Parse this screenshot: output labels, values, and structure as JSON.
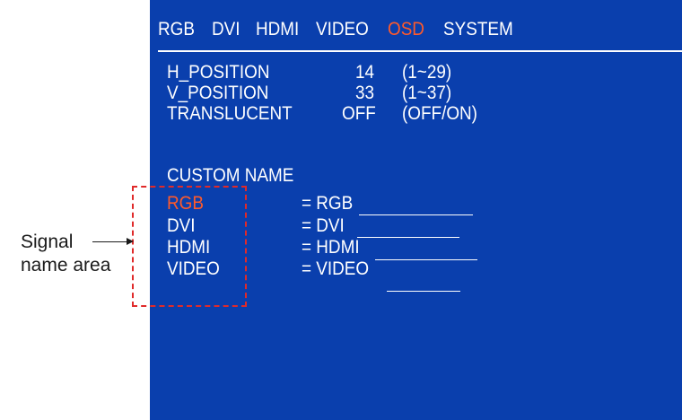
{
  "tabs": [
    {
      "label": "RGB",
      "active": false
    },
    {
      "label": "DVI",
      "active": false
    },
    {
      "label": "HDMI",
      "active": false
    },
    {
      "label": "VIDEO",
      "active": false
    },
    {
      "label": "OSD",
      "active": true
    },
    {
      "label": "SYSTEM",
      "active": false
    }
  ],
  "settings": [
    {
      "name": "H_POSITION",
      "value": "14",
      "range": "(1~29)"
    },
    {
      "name": "V_POSITION",
      "value": "33",
      "range": "(1~37)"
    },
    {
      "name": "TRANSLUCENT",
      "value": "OFF",
      "range": "(OFF/ON)"
    }
  ],
  "custom_name": {
    "heading": "CUSTOM NAME",
    "entries": [
      {
        "signal": "RGB",
        "value": "= RGB",
        "selected": true
      },
      {
        "signal": "DVI",
        "value": "= DVI",
        "selected": false
      },
      {
        "signal": "HDMI",
        "value": "= HDMI",
        "selected": false
      },
      {
        "signal": "VIDEO",
        "value": "= VIDEO",
        "selected": false
      }
    ]
  },
  "callout": {
    "line1": "Signal",
    "line2": "name area"
  },
  "colors": {
    "panel_background": "#0a3fad",
    "text": "#ffffff",
    "highlight": "#ff5a2a",
    "callout_box": "#e02a2a"
  }
}
